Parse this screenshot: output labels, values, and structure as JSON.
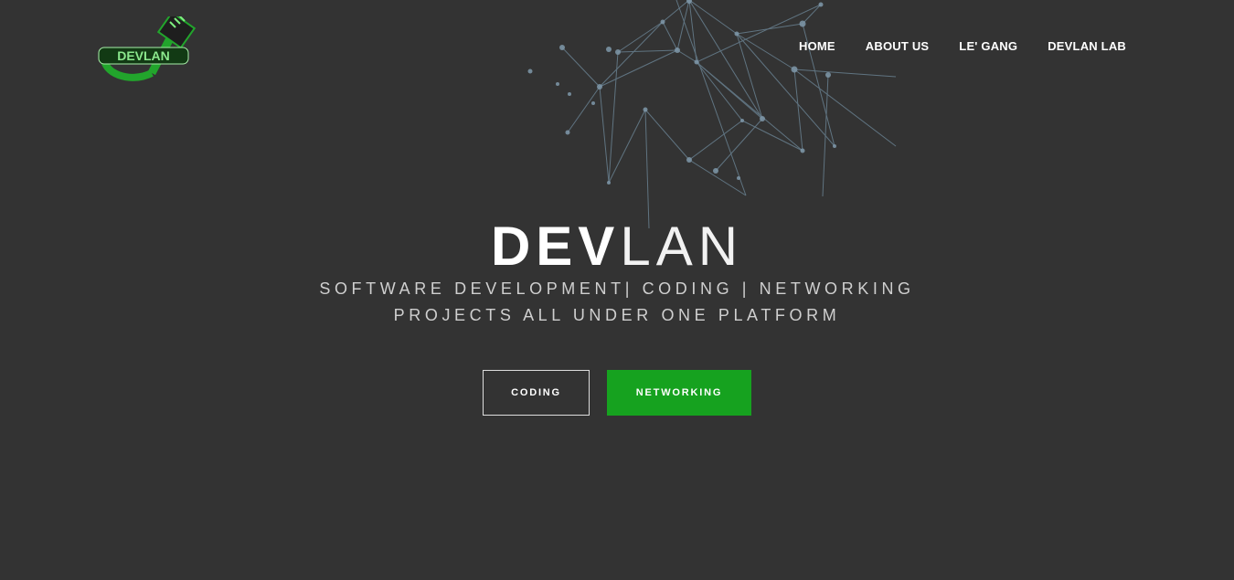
{
  "brand": {
    "logo_text": "DEVLAN",
    "logo_color": "#22a52c"
  },
  "nav": {
    "items": [
      {
        "label": "HOME"
      },
      {
        "label": "ABOUT US"
      },
      {
        "label": "LE' GANG"
      },
      {
        "label": "DEVLAN LAB"
      }
    ]
  },
  "hero": {
    "title_bold": "DEV",
    "title_light": "LAN",
    "subtitle_line1": "SOFTWARE DEVELOPMENT| CODING | NETWORKING",
    "subtitle_line2": "PROJECTS ALL UNDER ONE PLATFORM"
  },
  "buttons": {
    "coding_label": "CODING",
    "networking_label": "NETWORKING",
    "accent_color": "#16a21f"
  },
  "colors": {
    "background": "#333333",
    "network_lines": "#6f8a9c"
  }
}
